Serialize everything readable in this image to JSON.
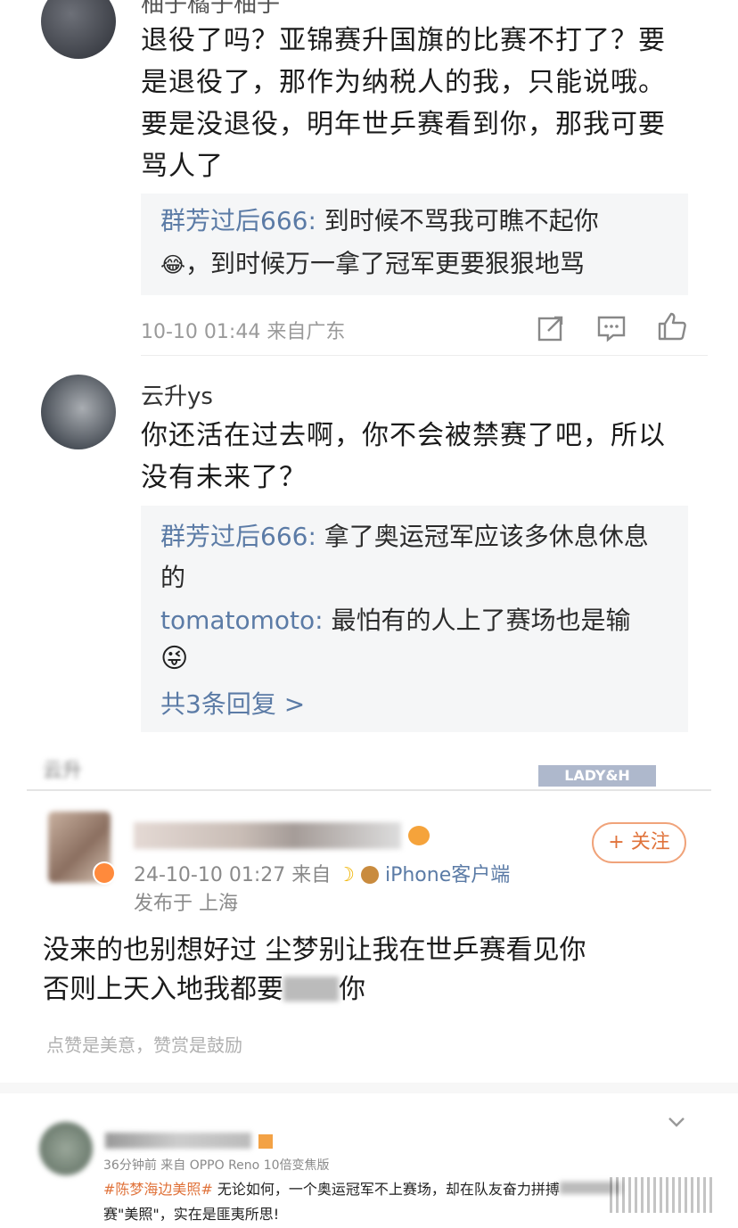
{
  "c1": {
    "name": "柚子橘子柚子",
    "text": "退役了吗？亚锦赛升国旗的比赛不打了？要是退役了，那作为纳税人的我，只能说哦。要是没退役，明年世乒赛看到你，那我可要骂人了",
    "replies": [
      {
        "name": "群芳过后666:",
        "text": "到时候不骂我可瞧不起你",
        "text2": "，到时候万一拿了冠军更要狠狠地骂",
        "emoji": "😂"
      }
    ],
    "meta": "10-10 01:44 来自广东"
  },
  "c2": {
    "name": "云升ys",
    "text": "你还活在过去啊，你不会被禁赛了吧，所以没有未来了？",
    "replies": [
      {
        "name": "群芳过后666:",
        "text": "拿了奥运冠军应该多休息休息的"
      },
      {
        "name": "tomatomoto:",
        "text": "最怕有的人上了赛场也是输",
        "emoji": "😜"
      }
    ],
    "more": "共3条回复 >"
  },
  "cut_label": "云升",
  "cut_badge": "LADY&H",
  "post": {
    "follow": "+ 关注",
    "meta1": "24-10-10 01:27 来自",
    "device": "iPhone客户端",
    "meta2": "发布于 上海",
    "line1": "没来的也别想好过 尘梦别让我在世乒赛看见你",
    "line2": "否则上天入地我都要",
    "line2_end": "你",
    "tip": "点赞是美意，赞赏是鼓励"
  },
  "c3": {
    "meta": "36分钟前  来自 OPPO Reno 10倍变焦版",
    "hashtag": "#陈梦海边美照#",
    "text": "无论如何，一个奥运冠军不上赛场，却在队友奋力拼搏",
    "text2": "赛\"美照\"，实在是匪夷所思!"
  }
}
